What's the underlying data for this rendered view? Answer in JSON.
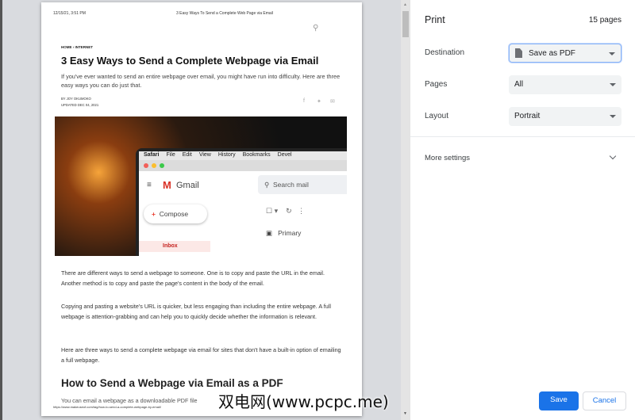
{
  "preview": {
    "header_date": "12/15/21, 3:51 PM",
    "header_title": "3 Easy Ways To Send a Complete Web Page via Email",
    "breadcrumb": "HOME  ›  INTERNET",
    "title": "3 Easy Ways to Send a Complete Webpage via Email",
    "lead": "If you've ever wanted to send an entire webpage over email, you might have run into difficulty. Here are three easy ways you can do just that.",
    "byline": "BY JOY OKUMOKO",
    "updated": "UPDATED DEC 04, 2021",
    "image": {
      "menu": [
        "Safari",
        "File",
        "Edit",
        "View",
        "History",
        "Bookmarks",
        "Devel"
      ],
      "app": "Gmail",
      "search": "Search mail",
      "compose": "Compose",
      "primary": "Primary",
      "inbox": "Inbox"
    },
    "paragraphs": [
      "There are different ways to send a webpage to someone. One is to copy and paste the URL in the email. Another method is to copy and paste the page's content in the body of the email.",
      "Copying and pasting a website's URL is quicker, but less engaging than including the entire webpage. A full webpage is attention-grabbing and can help you to quickly decide whether the information is relevant.",
      "Here are three ways to send a complete webpage via email for sites that don't have a built-in option of emailing a full webpage."
    ],
    "subheading": "How to Send a Webpage via Email as a PDF",
    "cut_text": "You can email a webpage as a downloadable PDF file",
    "footer_url": "https://www.makeuseof.com/tag/how-to-send-a-complete-webpage-by-email/"
  },
  "panel": {
    "title": "Print",
    "page_count": "15 pages",
    "destination_label": "Destination",
    "destination_value": "Save as PDF",
    "pages_label": "Pages",
    "pages_value": "All",
    "layout_label": "Layout",
    "layout_value": "Portrait",
    "more_settings": "More settings",
    "save": "Save",
    "cancel": "Cancel"
  },
  "watermark": "双电网(www.pcpc.me)",
  "colors": {
    "accent": "#1a73e8"
  }
}
